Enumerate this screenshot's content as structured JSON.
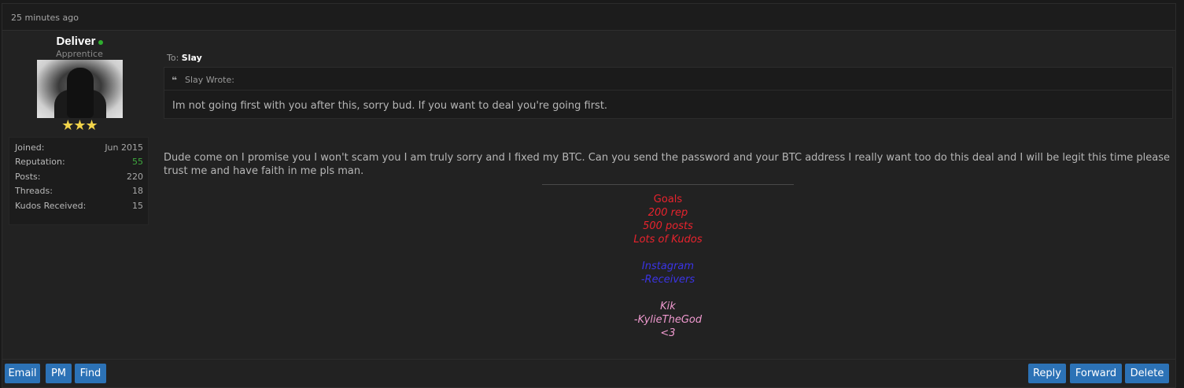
{
  "post": {
    "timestamp": "25 minutes ago"
  },
  "author": {
    "name": "Deliver",
    "rank": "Apprentice",
    "stars": "★★★",
    "stats": [
      {
        "label": "Joined:",
        "value": "Jun 2015"
      },
      {
        "label": "Reputation:",
        "value": "55"
      },
      {
        "label": "Posts:",
        "value": "220"
      },
      {
        "label": "Threads:",
        "value": "18"
      },
      {
        "label": "Kudos Received:",
        "value": "15"
      }
    ]
  },
  "to": {
    "prefix": "To:",
    "recipient": "Slay"
  },
  "quote": {
    "icon": "❝",
    "author": "Slay Wrote:",
    "text": "Im not going first with you after this, sorry bud. If you want to deal you're going first."
  },
  "message": "Dude come on I promise you I won't scam you I am truly sorry and I fixed my BTC. Can you send the password and your BTC address I really want too do this deal and I will be legit this time please trust me and have faith in me pls man.",
  "signature": {
    "goals_title": "Goals",
    "goals": [
      "200 rep",
      "500 posts",
      "Lots of Kudos"
    ],
    "instagram": [
      "Instagram",
      "-Receivers"
    ],
    "kik": [
      "Kik",
      "-KylieTheGod",
      "<3"
    ]
  },
  "buttons": {
    "left": [
      "Email",
      "PM",
      "Find"
    ],
    "right": [
      "Reply",
      "Forward",
      "Delete"
    ]
  },
  "colors": {
    "button": "#2c72b6",
    "online": "#2fae2f",
    "reputation": "#3fa93f",
    "sig_red": "#e8232d",
    "sig_blue": "#3b34e6",
    "sig_pink": "#f09ad0"
  }
}
